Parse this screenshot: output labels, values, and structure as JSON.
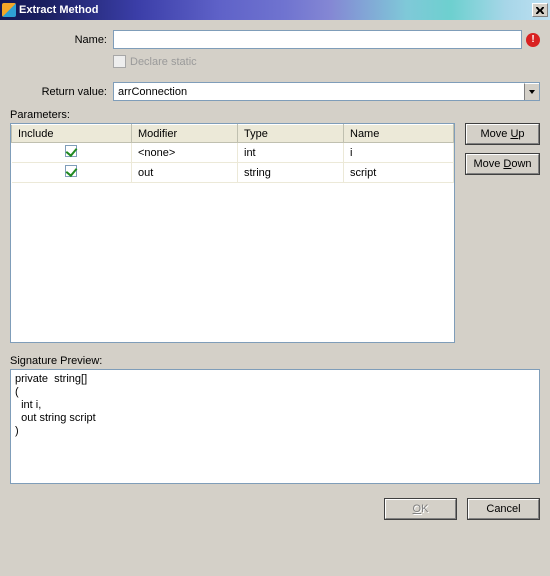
{
  "window": {
    "title": "Extract Method"
  },
  "form": {
    "name_label": "Name:",
    "name_value": "",
    "declare_static_label": "Declare static",
    "declare_static_checked": false,
    "declare_static_enabled": false,
    "return_value_label": "Return value:",
    "return_value_selected": "arrConnection"
  },
  "params": {
    "section_label": "Parameters:",
    "columns": {
      "include": "Include",
      "modifier": "Modifier",
      "type": "Type",
      "name": "Name"
    },
    "rows": [
      {
        "include": true,
        "modifier": "<none>",
        "type": "int",
        "name": "i"
      },
      {
        "include": true,
        "modifier": "out",
        "type": "string",
        "name": "script"
      }
    ]
  },
  "buttons": {
    "move_up": "Move Up",
    "move_up_u": "U",
    "move_down": "Move Down",
    "move_down_u": "D",
    "ok": "OK",
    "cancel": "Cancel"
  },
  "preview": {
    "label": "Signature Preview:",
    "text": "private  string[]\n(\n  int i,\n  out string script\n)"
  }
}
